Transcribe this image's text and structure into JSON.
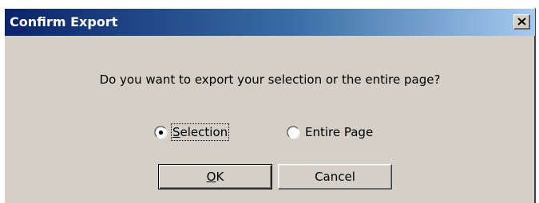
{
  "window": {
    "title": "Confirm Export",
    "close_icon": "close-icon"
  },
  "dialog": {
    "message": "Do you want to export your selection or the entire page?",
    "options": [
      {
        "label": "Selection",
        "selected": true
      },
      {
        "label": "Entire Page",
        "selected": false
      }
    ],
    "buttons": {
      "ok_label": "OK",
      "cancel_label": "Cancel"
    }
  },
  "colors": {
    "titlebar_start": "#0a246a",
    "titlebar_end": "#a6caf0",
    "dialog_background": "#d4d0c8"
  }
}
